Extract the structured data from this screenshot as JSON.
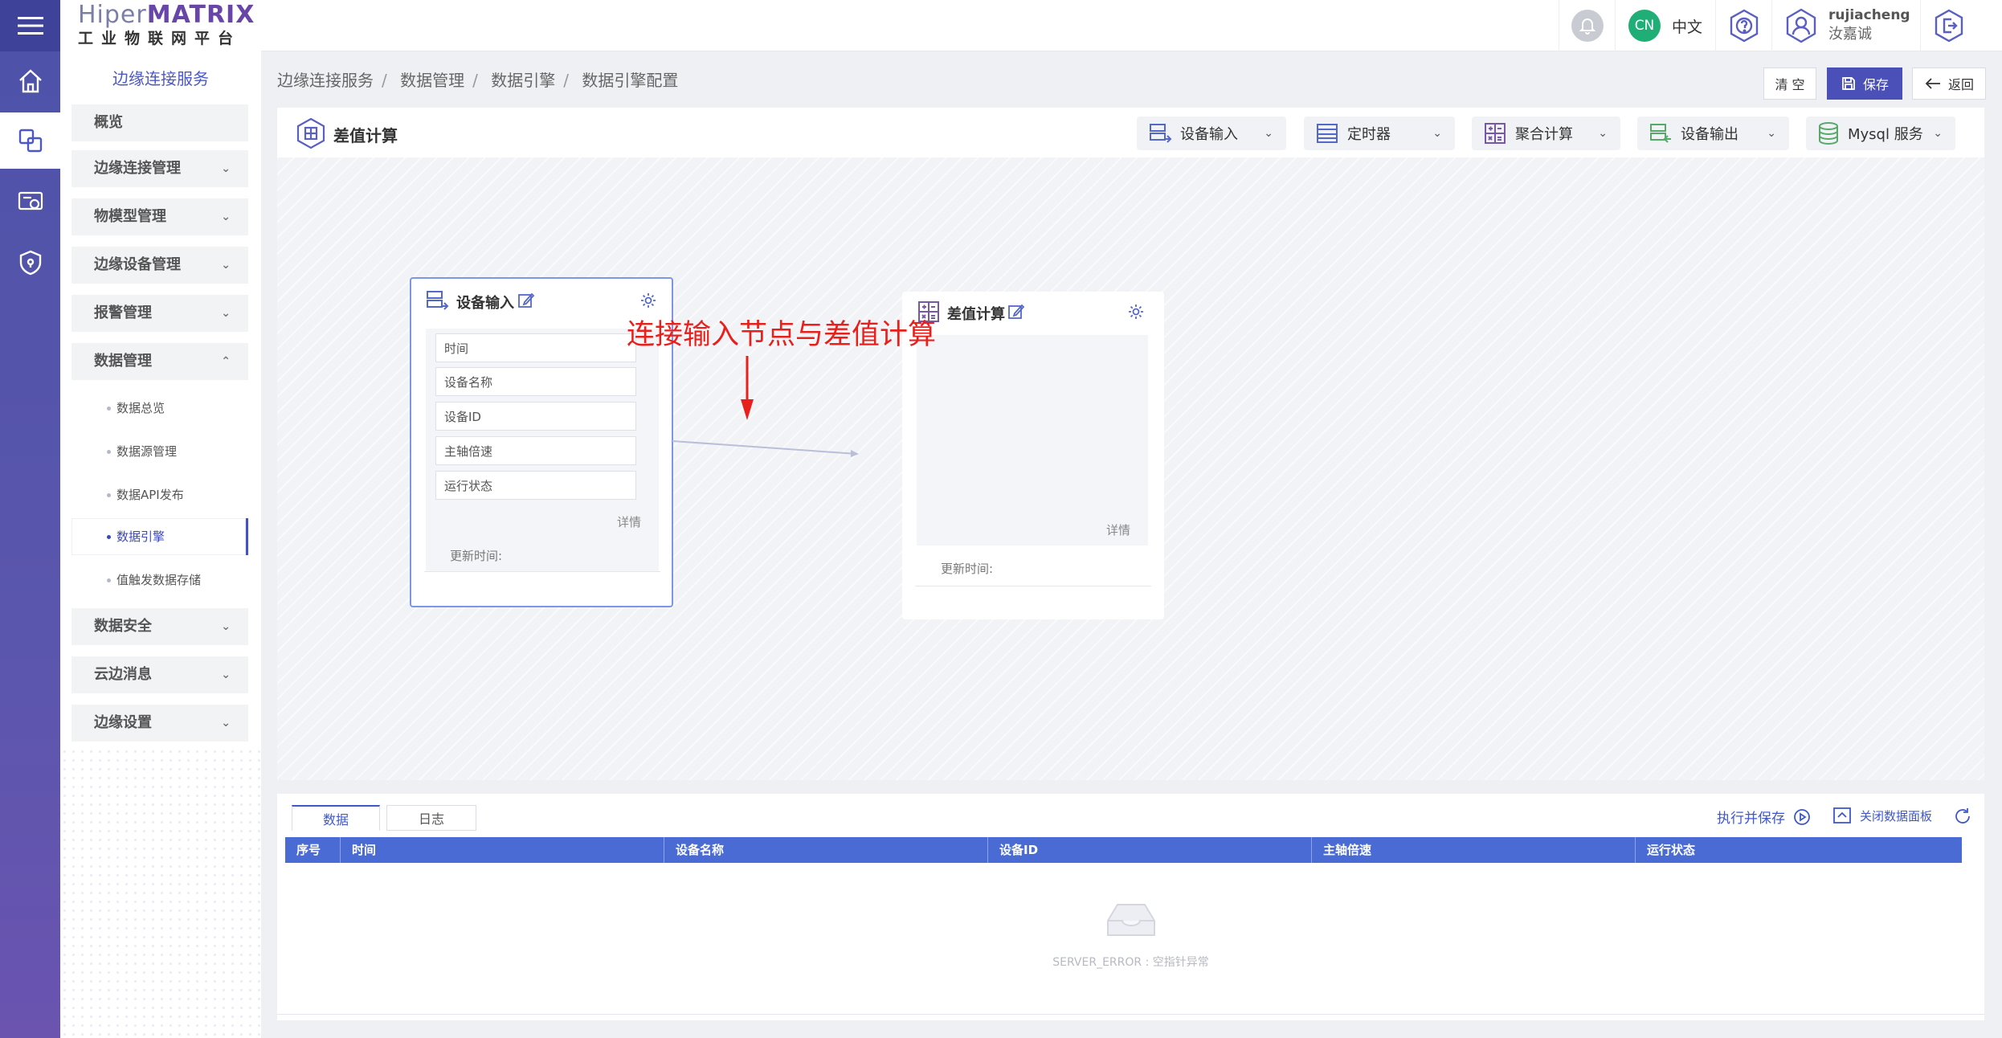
{
  "brand": {
    "logo_prefix": "Hiper",
    "logo_strong": "MATRIX",
    "logo_subtitle": "工业物联网平台",
    "accent": "#4b4fb8"
  },
  "rail": {
    "icons": [
      "menu-icon",
      "home-icon",
      "edge-service-icon",
      "monitor-icon",
      "security-shield-icon"
    ],
    "active_index": 1
  },
  "sidebar": {
    "title": "边缘连接服务",
    "items": [
      {
        "label": "概览",
        "expandable": false
      },
      {
        "label": "边缘连接管理",
        "expandable": true
      },
      {
        "label": "物模型管理",
        "expandable": true
      },
      {
        "label": "边缘设备管理",
        "expandable": true
      },
      {
        "label": "报警管理",
        "expandable": true
      },
      {
        "label": "数据管理",
        "expandable": true,
        "expanded": true
      },
      {
        "label": "数据安全",
        "expandable": true
      },
      {
        "label": "云边消息",
        "expandable": true
      },
      {
        "label": "边缘设置",
        "expandable": true
      }
    ],
    "data_mgmt_children": [
      {
        "label": "数据总览"
      },
      {
        "label": "数据源管理"
      },
      {
        "label": "数据API发布"
      },
      {
        "label": "数据引擎",
        "active": true
      },
      {
        "label": "值触发数据存储"
      }
    ]
  },
  "header": {
    "lang_badge": "CN",
    "lang_label": "中文",
    "user_name": "rujiacheng",
    "user_display": "汝嘉诚",
    "bell_icon": "bell-icon",
    "help_icon": "help-hexagon-icon",
    "user_icon": "user-hexagon-icon",
    "logout_icon": "logout-hexagon-icon"
  },
  "breadcrumb": {
    "items": [
      "边缘连接服务",
      "数据管理",
      "数据引擎",
      "数据引擎配置"
    ],
    "separator": "/"
  },
  "actions": {
    "clear": "清 空",
    "save": "保存",
    "back": "返回"
  },
  "canvas": {
    "title": "差值计算",
    "toolbar": [
      {
        "label": "设备输入",
        "icon": "device-input-icon"
      },
      {
        "label": "定时器",
        "icon": "timer-icon"
      },
      {
        "label": "聚合计算",
        "icon": "aggregate-calc-icon"
      },
      {
        "label": "设备输出",
        "icon": "device-output-icon"
      },
      {
        "label": "Mysql 服务",
        "icon": "database-icon"
      }
    ],
    "node_input": {
      "title": "设备输入",
      "fields": [
        "时间",
        "设备名称",
        "设备ID",
        "主轴倍速",
        "运行状态"
      ],
      "detail": "详情",
      "update_label": "更新时间:"
    },
    "node_diff": {
      "title": "差值计算",
      "detail": "详情",
      "update_label": "更新时间:"
    },
    "annotation": "连接输入节点与差值计算",
    "annotation_color": "#e8201c"
  },
  "data_panel": {
    "tabs": [
      "数据",
      "日志"
    ],
    "active_tab": 0,
    "run_save": "执行并保存",
    "close_panel": "关闭数据面板",
    "columns": [
      "序号",
      "时间",
      "设备名称",
      "设备ID",
      "主轴倍速",
      "运行状态"
    ],
    "empty_message": "SERVER_ERROR : 空指针异常",
    "header_color": "#4a6bd4"
  }
}
